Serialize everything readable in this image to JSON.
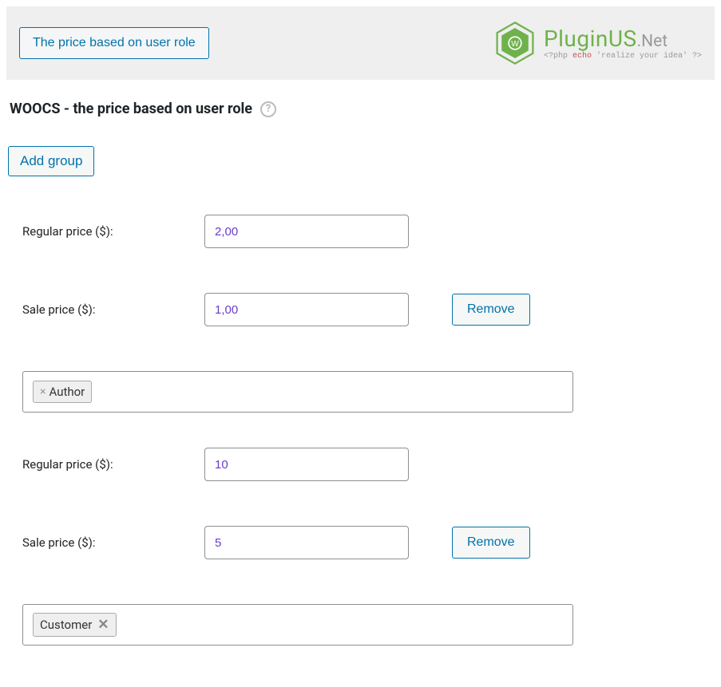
{
  "header": {
    "tab_label": "The price based on user role",
    "logo": {
      "main": "PluginUS",
      "suffix": ".Net",
      "tagline_prefix": "<?php ",
      "tagline_echo": "echo",
      "tagline_suffix": " 'realize your idea' ?>"
    }
  },
  "section": {
    "title": "WOOCS - the price based on user role",
    "help_symbol": "?"
  },
  "buttons": {
    "add_group": "Add group",
    "remove": "Remove"
  },
  "labels": {
    "regular_price": "Regular price ($):",
    "sale_price": "Sale price ($):"
  },
  "groups": [
    {
      "regular_price": "2,00",
      "sale_price": "1,00",
      "roles": [
        {
          "name": "Author",
          "close_style": "before"
        }
      ]
    },
    {
      "regular_price": "10",
      "sale_price": "5",
      "roles": [
        {
          "name": "Customer",
          "close_style": "after"
        }
      ]
    }
  ]
}
